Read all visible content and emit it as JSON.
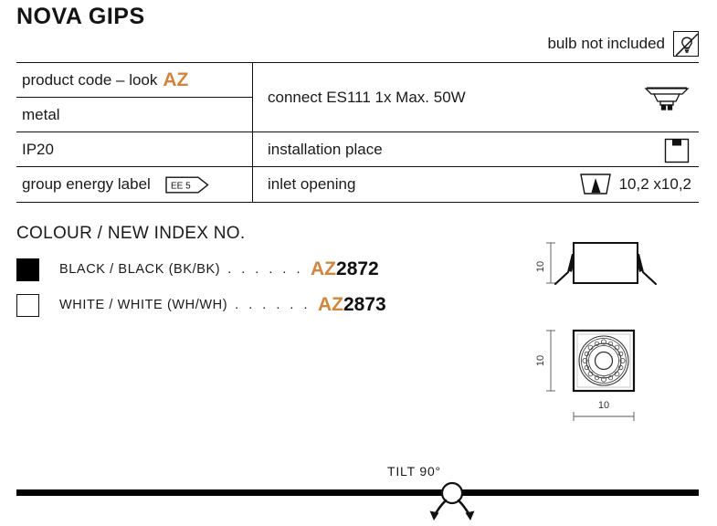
{
  "header": {
    "title": "NOVA GIPS",
    "bulb_note": "bulb not included",
    "bulb_icon": "bulb-not-included-icon"
  },
  "spec_table": {
    "left_column": [
      {
        "label": "product code – look",
        "accent": "AZ",
        "icon": null
      },
      {
        "label": "metal",
        "accent": null,
        "icon": null
      },
      {
        "label": "IP20",
        "accent": null,
        "icon": null
      },
      {
        "label": "group energy label",
        "accent": null,
        "icon": "energy-label-badge",
        "badge": "EE 5"
      }
    ],
    "right_column": [
      {
        "label": "connect ES111 1x Max. 50W",
        "icon": "es111-lamp-icon",
        "value": null
      },
      {
        "label": "installation place",
        "icon": "recessed-ceiling-icon",
        "value": null
      },
      {
        "label": "inlet opening",
        "icon": "inlet-trapezoid-icon",
        "value": "10,2 x10,2"
      }
    ]
  },
  "colour_section": {
    "heading": "COLOUR / NEW INDEX NO.",
    "dots": ". . . . . .",
    "items": [
      {
        "swatch": "black",
        "name": "BLACK / BLACK (BK/BK)",
        "code_prefix": "AZ",
        "code_number": "2872"
      },
      {
        "swatch": "white",
        "name": "WHITE / WHITE (WH/WH)",
        "code_prefix": "AZ",
        "code_number": "2873"
      }
    ]
  },
  "drawings": {
    "side_view": {
      "name": "side-view-drawing",
      "height_label": "10"
    },
    "front_view": {
      "name": "front-view-drawing",
      "height_label": "10",
      "width_label": "10"
    }
  },
  "tilt": {
    "label": "TILT 90°",
    "graphic": "tilt-arrows-icon"
  },
  "colors": {
    "accent_orange": "#D4853C",
    "ink": "#1a1a1a",
    "rule": "#111111"
  }
}
